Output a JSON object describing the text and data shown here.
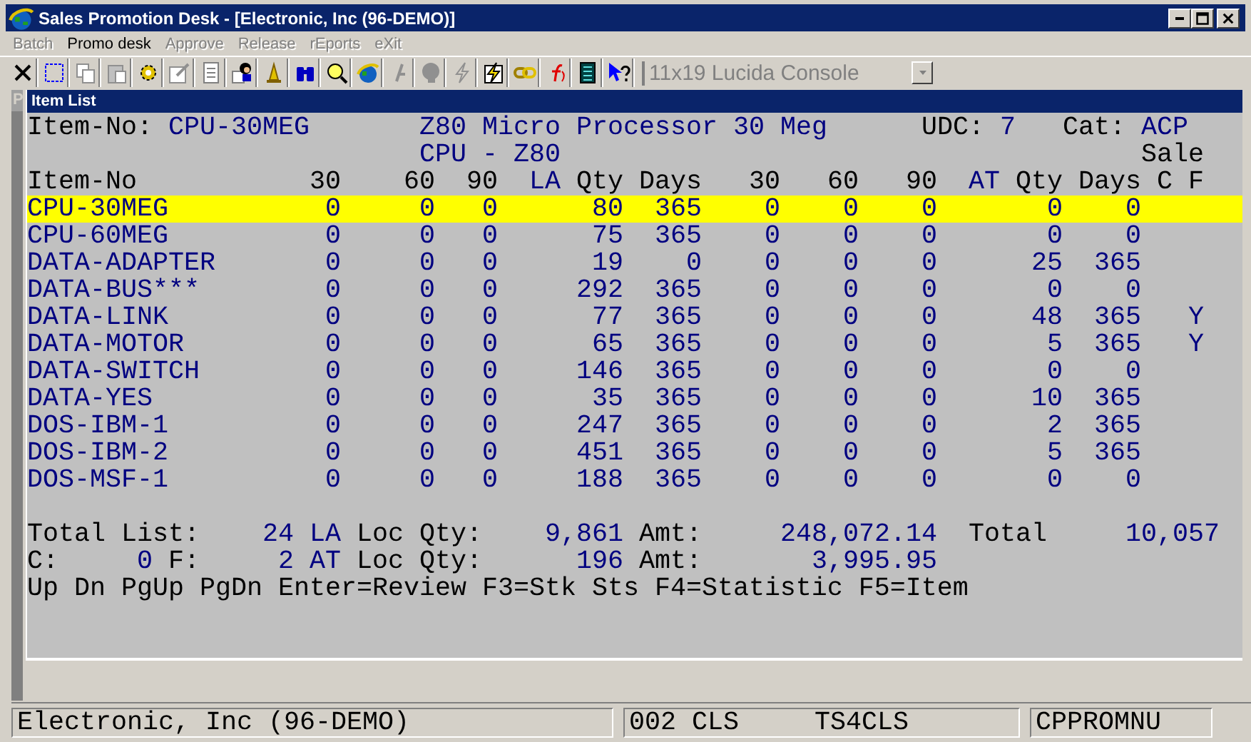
{
  "window": {
    "title": "Sales Promotion Desk - [Electronic, Inc (96-DEMO)]"
  },
  "menu": [
    {
      "label": "Batch",
      "disabled": true
    },
    {
      "label": "Promo desk",
      "disabled": false
    },
    {
      "label": "Approve",
      "disabled": true
    },
    {
      "label": "Release",
      "disabled": true
    },
    {
      "label": "rEports",
      "disabled": true
    },
    {
      "label": "eXit",
      "disabled": true
    }
  ],
  "toolbar": {
    "font_box": {
      "value": "11x19 Lucida Console",
      "disabled": true
    }
  },
  "background_window": {
    "title": "P"
  },
  "item_list": {
    "title": "Item List",
    "header_lines": [
      [
        {
          "text": "Item-No:",
          "kind": "label"
        },
        {
          "text": "CPU-30MEG",
          "kind": "value"
        },
        {
          "text": "Z80 Micro Processor 30 Meg",
          "kind": "value"
        },
        {
          "text": "UDC:",
          "kind": "label"
        },
        {
          "text": "7",
          "kind": "value"
        },
        {
          "text": "Cat:",
          "kind": "label"
        },
        {
          "text": "ACP",
          "kind": "value"
        }
      ],
      [
        {
          "text": "CPU - Z80",
          "kind": "value"
        },
        {
          "text": "Sale",
          "kind": "label"
        }
      ]
    ],
    "columns": [
      {
        "label": "Item-No",
        "color": "#000000"
      },
      {
        "label": "30",
        "color": "#000000"
      },
      {
        "label": "60",
        "color": "#000000"
      },
      {
        "label": "90",
        "color": "#000000"
      },
      {
        "label": "LA",
        "color": "#000080"
      },
      {
        "label": "Qty",
        "color": "#000000"
      },
      {
        "label": "Days",
        "color": "#000000"
      },
      {
        "label": "30",
        "color": "#000000"
      },
      {
        "label": "60",
        "color": "#000000"
      },
      {
        "label": "90",
        "color": "#000000"
      },
      {
        "label": "AT",
        "color": "#000080"
      },
      {
        "label": "Qty",
        "color": "#000000"
      },
      {
        "label": "Days",
        "color": "#000000"
      },
      {
        "label": "C",
        "color": "#000000"
      },
      {
        "label": "F",
        "color": "#000000"
      }
    ],
    "rows": [
      {
        "item_no": "CPU-30MEG",
        "la": [
          "0",
          "0",
          "0",
          "80",
          "365"
        ],
        "at": [
          "0",
          "0",
          "0",
          "0",
          "0"
        ],
        "selected": true
      },
      {
        "item_no": "CPU-60MEG",
        "la": [
          "0",
          "0",
          "0",
          "75",
          "365"
        ],
        "at": [
          "0",
          "0",
          "0",
          "0",
          "0"
        ],
        "selected": false
      },
      {
        "item_no": "DATA-ADAPTER",
        "la": [
          "0",
          "0",
          "0",
          "19",
          "0"
        ],
        "at": [
          "0",
          "0",
          "0",
          "25",
          "365"
        ],
        "selected": false
      },
      {
        "item_no": "DATA-BUS***",
        "la": [
          "0",
          "0",
          "0",
          "292",
          "365"
        ],
        "at": [
          "0",
          "0",
          "0",
          "0",
          "0"
        ],
        "selected": false
      },
      {
        "item_no": "DATA-LINK",
        "la": [
          "0",
          "0",
          "0",
          "77",
          "365"
        ],
        "at": [
          "0",
          "0",
          "0",
          "48",
          "365"
        ],
        "f": "Y",
        "selected": false
      },
      {
        "item_no": "DATA-MOTOR",
        "la": [
          "0",
          "0",
          "0",
          "65",
          "365"
        ],
        "at": [
          "0",
          "0",
          "0",
          "5",
          "365"
        ],
        "f": "Y",
        "selected": false
      },
      {
        "item_no": "DATA-SWITCH",
        "la": [
          "0",
          "0",
          "0",
          "146",
          "365"
        ],
        "at": [
          "0",
          "0",
          "0",
          "0",
          "0"
        ],
        "selected": false
      },
      {
        "item_no": "DATA-YES",
        "la": [
          "0",
          "0",
          "0",
          "35",
          "365"
        ],
        "at": [
          "0",
          "0",
          "0",
          "10",
          "365"
        ],
        "selected": false
      },
      {
        "item_no": "DOS-IBM-1",
        "la": [
          "0",
          "0",
          "0",
          "247",
          "365"
        ],
        "at": [
          "0",
          "0",
          "0",
          "2",
          "365"
        ],
        "selected": false
      },
      {
        "item_no": "DOS-IBM-2",
        "la": [
          "0",
          "0",
          "0",
          "451",
          "365"
        ],
        "at": [
          "0",
          "0",
          "0",
          "5",
          "365"
        ],
        "selected": false
      },
      {
        "item_no": "DOS-MSF-1",
        "la": [
          "0",
          "0",
          "0",
          "188",
          "365"
        ],
        "at": [
          "0",
          "0",
          "0",
          "0",
          "0"
        ],
        "selected": false
      }
    ],
    "total_lines": [
      [
        {
          "text": "Total List:",
          "kind": "label"
        },
        {
          "text": "24",
          "kind": "value"
        },
        {
          "text": "LA",
          "kind": "value"
        },
        {
          "text": "Loc Qty:",
          "kind": "label"
        },
        {
          "text": "9,861",
          "kind": "value"
        },
        {
          "text": "Amt:",
          "kind": "label"
        },
        {
          "text": "248,072.14",
          "kind": "value"
        },
        {
          "text": "Total",
          "kind": "label"
        },
        {
          "text": "10,057",
          "kind": "value"
        }
      ],
      [
        {
          "text": "C:",
          "kind": "label"
        },
        {
          "text": "0",
          "kind": "value"
        },
        {
          "text": "F:",
          "kind": "label"
        },
        {
          "text": "2",
          "kind": "value"
        },
        {
          "text": "AT",
          "kind": "value"
        },
        {
          "text": "Loc Qty:",
          "kind": "label"
        },
        {
          "text": "196",
          "kind": "value"
        },
        {
          "text": "Amt:",
          "kind": "label"
        },
        {
          "text": "3,995.95",
          "kind": "value"
        }
      ]
    ],
    "key_help": "Up Dn PgUp PgDn Enter=Review F3=Stk Sts F4=Statistic F5=Item"
  },
  "status_bar": {
    "panes": [
      {
        "texts": [
          "Electronic, Inc (96-DEMO)"
        ]
      },
      {
        "texts": [
          "002 CLS",
          "TS4CLS"
        ]
      },
      {
        "texts": [
          "CPPROMNU"
        ]
      }
    ]
  }
}
